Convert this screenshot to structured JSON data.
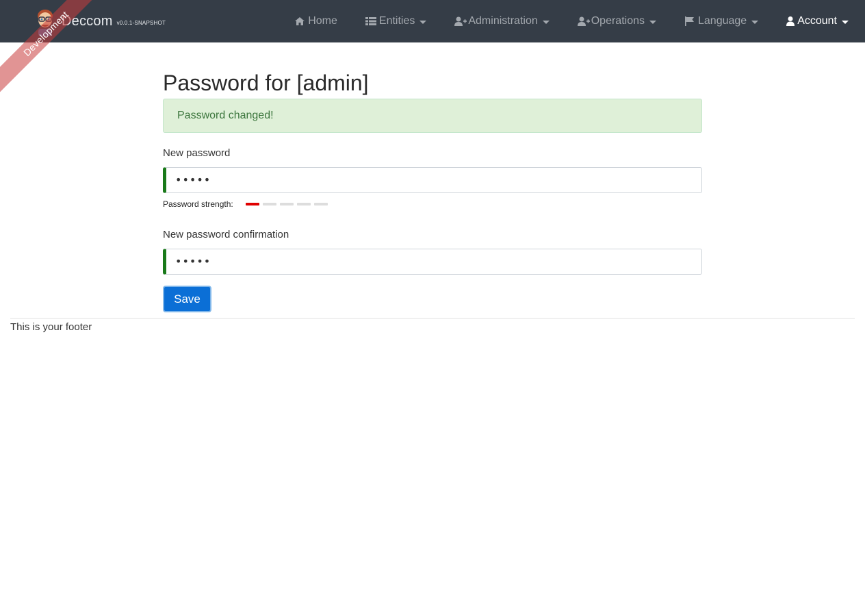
{
  "app": {
    "brand": "Deccom",
    "version": "v0.0.1-SNAPSHOT",
    "ribbon": "Development"
  },
  "nav": {
    "items": [
      {
        "label": "Home",
        "icon": "home-icon",
        "dropdown": false
      },
      {
        "label": "Entities",
        "icon": "list-icon",
        "dropdown": true
      },
      {
        "label": "Administration",
        "icon": "user-plus-icon",
        "dropdown": true
      },
      {
        "label": "Operations",
        "icon": "user-plus-icon",
        "dropdown": true
      },
      {
        "label": "Language",
        "icon": "flag-icon",
        "dropdown": true
      },
      {
        "label": "Account",
        "icon": "user-icon",
        "dropdown": true
      }
    ]
  },
  "page": {
    "title_prefix": "Password for [",
    "title_user": "admin",
    "title_suffix": "]",
    "alert": "Password changed!"
  },
  "form": {
    "new_password_label": "New password",
    "new_password_value": "•••••",
    "strength_label": "Password strength:",
    "strength_level": 1,
    "strength_max": 5,
    "confirm_label": "New password confirmation",
    "confirm_value": "•••••",
    "save_label": "Save"
  },
  "footer": {
    "text": "This is your footer"
  },
  "colors": {
    "navbar": "#353d47",
    "alert_bg": "#dff0d8",
    "alert_text": "#3c763d",
    "primary": "#0b6fd6",
    "valid_border": "#1a7a1a",
    "strength_weak": "#e00000"
  }
}
